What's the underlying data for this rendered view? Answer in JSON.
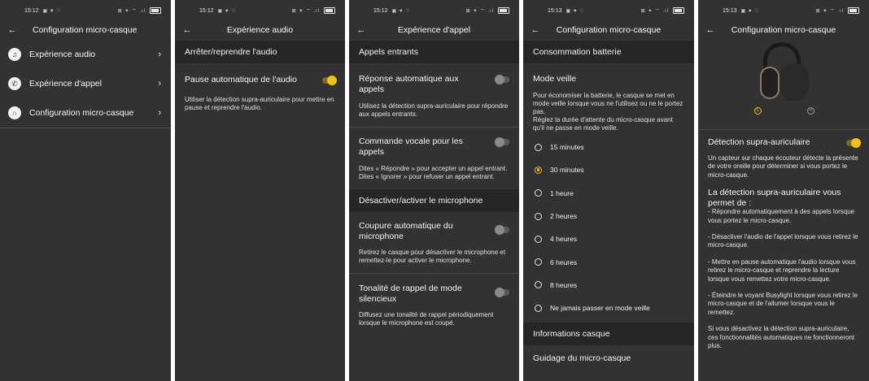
{
  "status": {
    "time_a": "15:12",
    "time_b": "15:13",
    "left_icons": "▣ ♥ ♡",
    "right_icons": "⊠ ✦ ⌔ .ıl"
  },
  "s1": {
    "title": "Configuration micro-casque",
    "items": [
      {
        "label": "Expérience audio",
        "icon": "music-note-icon",
        "glyph": "♫"
      },
      {
        "label": "Expérience d'appel",
        "icon": "phone-icon",
        "glyph": "✆"
      },
      {
        "label": "Configuration micro-casque",
        "icon": "headset-icon",
        "glyph": "∩"
      }
    ]
  },
  "s2": {
    "title": "Expérience audio",
    "section": "Arrêter/reprendre l'audio",
    "pause_title": "Pause automatique de l'audio",
    "pause_desc": "Utiliser la détection supra-auriculaire pour mettre en pause et reprendre l'audio.",
    "pause_on": true
  },
  "s3": {
    "title": "Expérience d'appel",
    "section_incoming": "Appels entrants",
    "auto_answer_title": "Réponse automatique aux appels",
    "auto_answer_desc": "Utilisez la détection supra-auriculaire pour répondre aux appels entrants.",
    "voice_title": "Commande vocale pour les appels",
    "voice_desc": "Dites « Répondre » pour accepter un appel entrant.\nDites « Ignorer » pour refuser un appel entrant.",
    "section_mic": "Désactiver/activer le microphone",
    "mute_title": "Coupure automatique du microphone",
    "mute_desc": "Retirez le casque pour désactiver le microphone et remettez-le pour activer le microphone.",
    "reminder_title": "Tonalité de rappel de mode silencieux",
    "reminder_desc": "Diffusez une tonalité de rappel périodiquement lorsque le microphone est coupé."
  },
  "s4": {
    "title": "Configuration micro-casque",
    "section_battery": "Consommation batterie",
    "standby_title": "Mode veille",
    "standby_desc": "Pour économiser la batterie, le casque se met en mode veille lorsque vous ne l'utilisez ou ne le portez pas.\nRéglez la durée d'attente du micro-casque avant qu'il ne passe en mode veille.",
    "options": [
      "15 minutes",
      "30 minutes",
      "1 heure",
      "2 heures",
      "4 heures",
      "6 heures",
      "8 heures",
      "Ne jamais passer en mode veille"
    ],
    "selected_index": 1,
    "section_info": "Informations casque",
    "guide": "Guidage du micro-casque"
  },
  "s5": {
    "title": "Configuration micro-casque",
    "marker_left": "L",
    "marker_right": "R",
    "detect_title": "Détection supra-auriculaire",
    "detect_on": true,
    "detect_desc": "Un capteur sur chaque écouteur détecte la présente de votre oreille pour déterminer si vous portez le micro-casque.",
    "allows_head": "La détection supra-auriculaire vous permet de :",
    "allows_1": "- Répondre automatiquement à des appels lorsque vous portez le micro-casque.",
    "allows_2": "- Désactiver l'audio de l'appel lorsque vous retirez le micro-casque.",
    "allows_3": "- Mettre en pause automatique l'audio lorsque vous retirez le micro-casque et reprendre la lecture lorsque vous remettez votre micro-casque.",
    "allows_4": "- Éteindre le voyant Busylight lorsque vous retirez le micro-casque et de l'allumer lorsque vous le remettez.",
    "footer": "Si vous désactivez la détection supra-auriculaire, ces fonctionnalités automatiques ne fonctionneront plus."
  },
  "colors": {
    "background": "#323232",
    "section": "#262626",
    "accent": "#f4c20d"
  }
}
